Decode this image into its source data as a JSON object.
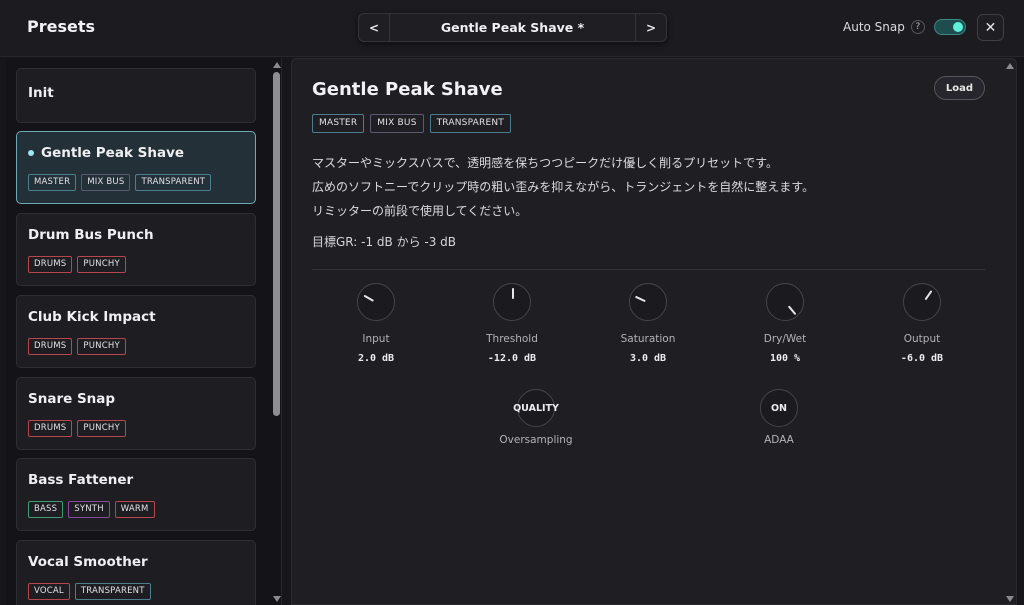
{
  "header": {
    "title": "Presets",
    "prev_label": "<",
    "next_label": ">",
    "current_preset": "Gentle Peak Shave *",
    "auto_snap_label": "Auto Snap",
    "help_label": "?",
    "auto_snap_on": true,
    "close_label": "✕"
  },
  "presets": [
    {
      "name": "Init",
      "tags": []
    },
    {
      "name": "Gentle Peak Shave",
      "selected": true,
      "tags": [
        "MASTER",
        "MIX BUS",
        "TRANSPARENT"
      ]
    },
    {
      "name": "Drum Bus Punch",
      "tags": [
        "DRUMS",
        "PUNCHY"
      ]
    },
    {
      "name": "Club Kick Impact",
      "tags": [
        "DRUMS",
        "PUNCHY"
      ]
    },
    {
      "name": "Snare Snap",
      "tags": [
        "DRUMS",
        "PUNCHY"
      ]
    },
    {
      "name": "Bass Fattener",
      "tags": [
        "BASS",
        "SYNTH",
        "WARM"
      ]
    },
    {
      "name": "Vocal Smoother",
      "tags": [
        "VOCAL",
        "TRANSPARENT"
      ]
    }
  ],
  "detail": {
    "title": "Gentle Peak Shave",
    "load_label": "Load",
    "tags": [
      "MASTER",
      "MIX BUS",
      "TRANSPARENT"
    ],
    "description": [
      "マスターやミックスバスで、透明感を保ちつつピークだけ優しく削るプリセットです。",
      "広めのソフトニーでクリップ時の粗い歪みを抑えながら、トランジェントを自然に整えます。",
      "リミッターの前段で使用してください。"
    ],
    "target_gr": "目標GR: -1 dB から -3 dB",
    "knobs": [
      {
        "label": "Input",
        "value": "2.0 dB"
      },
      {
        "label": "Threshold",
        "value": "-12.0 dB"
      },
      {
        "label": "Saturation",
        "value": "3.0 dB"
      },
      {
        "label": "Dry/Wet",
        "value": "100 %"
      },
      {
        "label": "Output",
        "value": "-6.0 dB"
      }
    ],
    "switches": [
      {
        "label": "Oversampling",
        "value": "QUALITY"
      },
      {
        "label": "ADAA",
        "value": "ON"
      }
    ]
  }
}
